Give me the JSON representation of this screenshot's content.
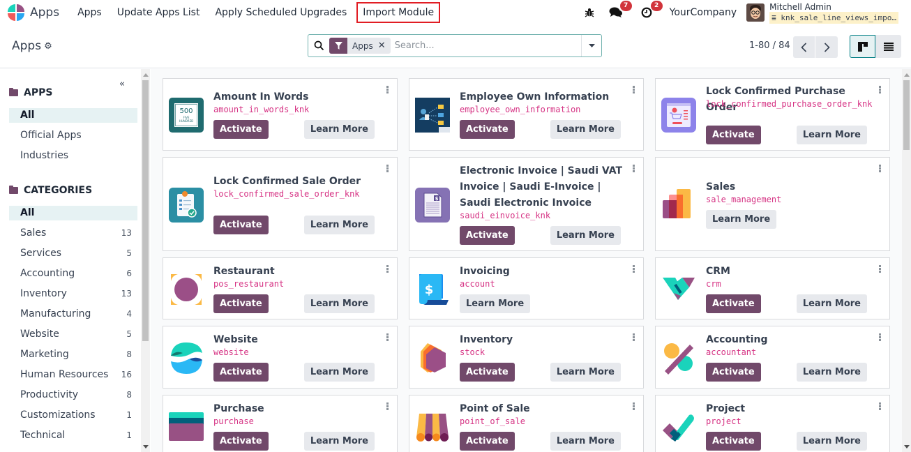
{
  "navbar": {
    "brand": "Apps",
    "menu": [
      "Apps",
      "Update Apps List",
      "Apply Scheduled Upgrades",
      "Import Module"
    ],
    "debug_icon": "bug-icon",
    "messages_count": "7",
    "activities_count": "2",
    "company": "YourCompany",
    "user_name": "Mitchell Admin",
    "database": "knk_sale_line_views_impo…"
  },
  "control": {
    "title": "Apps",
    "facet_label": "Apps",
    "search_placeholder": "Search...",
    "pager": "1-80 / 84"
  },
  "sidebar": {
    "apps_header": "APPS",
    "apps_items": [
      {
        "label": "All",
        "active": true
      },
      {
        "label": "Official Apps"
      },
      {
        "label": "Industries"
      }
    ],
    "categories_header": "CATEGORIES",
    "categories": [
      {
        "label": "All",
        "count": "",
        "active": true
      },
      {
        "label": "Sales",
        "count": "13"
      },
      {
        "label": "Services",
        "count": "5"
      },
      {
        "label": "Accounting",
        "count": "6"
      },
      {
        "label": "Inventory",
        "count": "13"
      },
      {
        "label": "Manufacturing",
        "count": "4"
      },
      {
        "label": "Website",
        "count": "5"
      },
      {
        "label": "Marketing",
        "count": "8"
      },
      {
        "label": "Human Resources",
        "count": "16"
      },
      {
        "label": "Productivity",
        "count": "8"
      },
      {
        "label": "Customizations",
        "count": "1"
      },
      {
        "label": "Technical",
        "count": "1"
      }
    ]
  },
  "buttons": {
    "activate": "Activate",
    "learn_more": "Learn More"
  },
  "apps": [
    {
      "name": "Amount In Words",
      "tech": "amount_in_words_knk",
      "activate": true,
      "icon": "amount-in-words-icon",
      "icon_text": [
        "500",
        "FIVE",
        "HUNDRED"
      ]
    },
    {
      "name": "Employee Own Information",
      "tech": "employee_own_information",
      "activate": true,
      "icon": "employee-info-icon"
    },
    {
      "name": "Lock Confirmed Purchase Order",
      "tech": "lock_confirmed_purchase_order_knk",
      "activate": true,
      "icon": "lock-purchase-order-icon"
    },
    {
      "name": "Lock Confirmed Sale Order",
      "tech": "lock_confirmed_sale_order_knk",
      "activate": true,
      "icon": "lock-sale-order-icon"
    },
    {
      "name": "Electronic Invoice | Saudi VAT Invoice | Saudi E-Invoice | Saudi Electronic Invoice",
      "tech": "saudi_einvoice_knk",
      "activate": true,
      "icon": "saudi-einvoice-icon"
    },
    {
      "name": "Sales",
      "tech": "sale_management",
      "activate": false,
      "icon": "sales-icon"
    },
    {
      "name": "Restaurant",
      "tech": "pos_restaurant",
      "activate": true,
      "icon": "restaurant-icon"
    },
    {
      "name": "Invoicing",
      "tech": "account",
      "activate": false,
      "icon": "invoicing-icon"
    },
    {
      "name": "CRM",
      "tech": "crm",
      "activate": true,
      "icon": "crm-icon"
    },
    {
      "name": "Website",
      "tech": "website",
      "activate": true,
      "icon": "website-icon"
    },
    {
      "name": "Inventory",
      "tech": "stock",
      "activate": true,
      "icon": "inventory-icon"
    },
    {
      "name": "Accounting",
      "tech": "accountant",
      "activate": true,
      "icon": "accounting-icon"
    },
    {
      "name": "Purchase",
      "tech": "purchase",
      "activate": true,
      "icon": "purchase-icon"
    },
    {
      "name": "Point of Sale",
      "tech": "point_of_sale",
      "activate": true,
      "icon": "point-of-sale-icon"
    },
    {
      "name": "Project",
      "tech": "project",
      "activate": true,
      "icon": "project-icon"
    }
  ]
}
